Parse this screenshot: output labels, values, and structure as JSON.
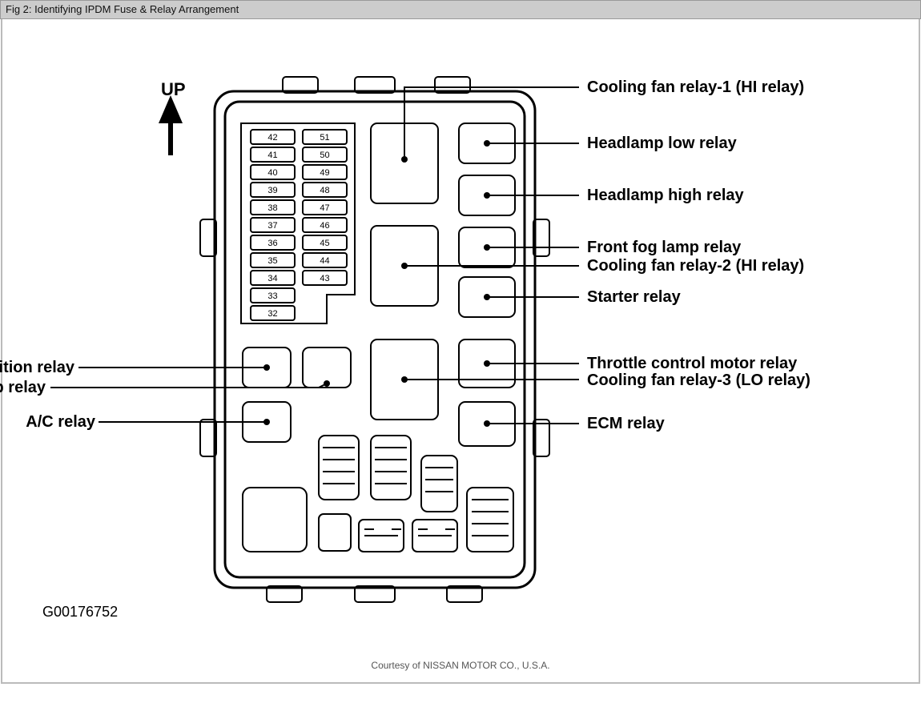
{
  "title": "Fig 2: Identifying IPDM Fuse & Relay Arrangement",
  "up_label": "UP",
  "fuses_left": [
    "42",
    "41",
    "40",
    "39",
    "38",
    "37",
    "36",
    "35",
    "34",
    "33",
    "32"
  ],
  "fuses_right": [
    "51",
    "50",
    "49",
    "48",
    "47",
    "46",
    "45",
    "44",
    "43"
  ],
  "callouts": {
    "ignition": "Ignition relay",
    "fuel_pump": "Fuel pump relay",
    "ac": "A/C relay",
    "cooling1": "Cooling fan relay-1 (HI relay)",
    "headlamp_low": "Headlamp low relay",
    "headlamp_high": "Headlamp high relay",
    "front_fog": "Front fog lamp relay",
    "cooling2": "Cooling fan relay-2 (HI relay)",
    "starter": "Starter relay",
    "throttle": "Throttle control motor relay",
    "cooling3": "Cooling fan relay-3 (LO relay)",
    "ecm": "ECM relay"
  },
  "diagram_id": "G00176752",
  "credit": "Courtesy of NISSAN MOTOR CO., U.S.A."
}
